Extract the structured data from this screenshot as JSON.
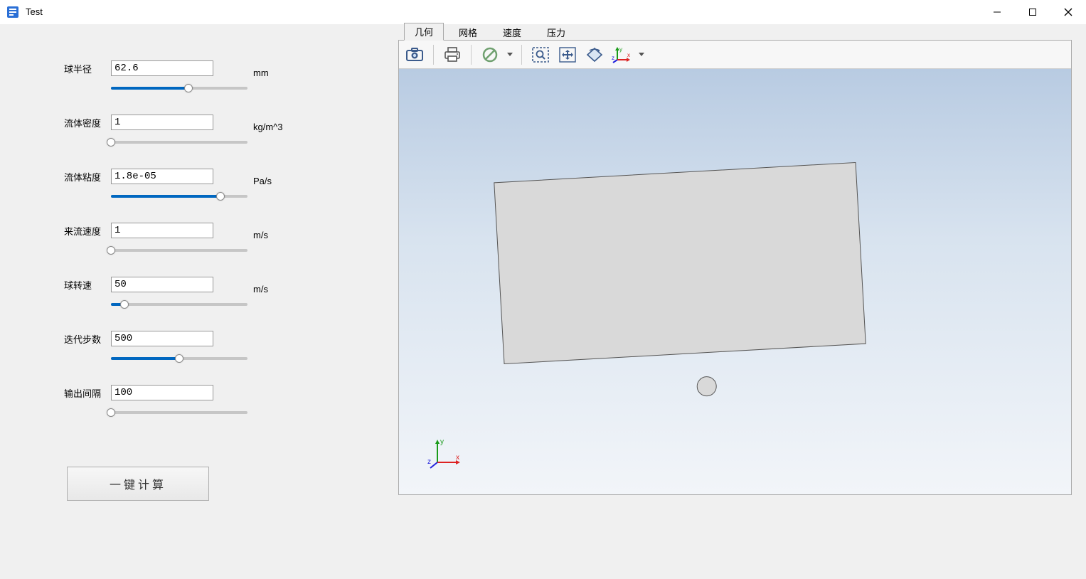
{
  "window": {
    "title": "Test"
  },
  "params": [
    {
      "label": "球半径",
      "value": "62.6",
      "unit": "mm",
      "slider_percent": 57
    },
    {
      "label": "流体密度",
      "value": "1",
      "unit": "kg/m^3",
      "slider_percent": 0
    },
    {
      "label": "流体粘度",
      "value": "1.8e-05",
      "unit": "Pa/s",
      "slider_percent": 80
    },
    {
      "label": "来流速度",
      "value": "1",
      "unit": "m/s",
      "slider_percent": 0
    },
    {
      "label": "球转速",
      "value": "50",
      "unit": "m/s",
      "slider_percent": 10
    },
    {
      "label": "迭代步数",
      "value": "500",
      "unit": "",
      "slider_percent": 50
    },
    {
      "label": "输出间隔",
      "value": "100",
      "unit": "",
      "slider_percent": 0
    }
  ],
  "calc_button": "一键计算",
  "tabs": [
    {
      "label": "几何",
      "active": true
    },
    {
      "label": "网格",
      "active": false
    },
    {
      "label": "速度",
      "active": false
    },
    {
      "label": "压力",
      "active": false
    }
  ],
  "toolbar_icons": {
    "camera": "camera-icon",
    "print": "print-icon",
    "nodata": "no-sign-icon",
    "zoombox": "zoom-box-icon",
    "pan": "pan-arrows-icon",
    "rotate": "rotate-view-icon",
    "axes": "axes-triad-icon"
  },
  "axes_labels": {
    "x": "x",
    "y": "y",
    "z": "z"
  }
}
